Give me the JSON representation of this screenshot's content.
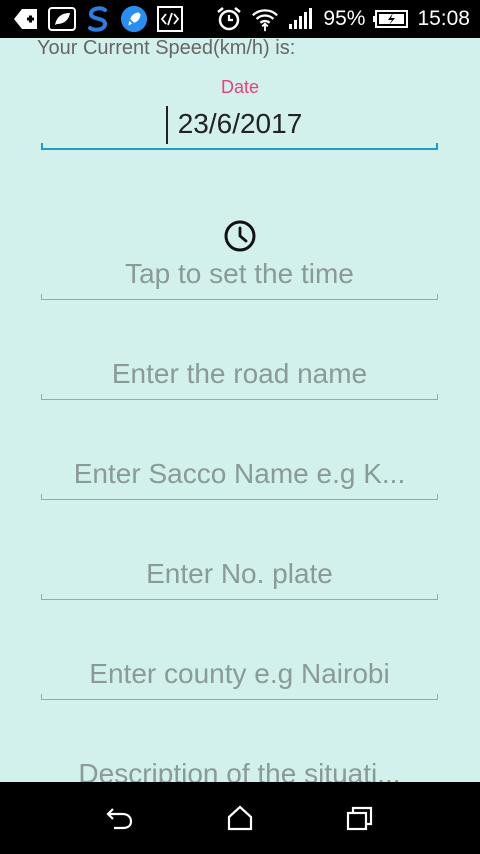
{
  "status_bar": {
    "battery_percent": "95%",
    "time": "15:08",
    "icons": [
      "add-notification-icon",
      "leaf-icon",
      "s-app-icon",
      "rocket-icon",
      "code-icon",
      "alarm-icon",
      "wifi-icon",
      "signal-icon",
      "battery-charging-icon"
    ]
  },
  "form": {
    "speed_label": "Your Current Speed(km/h) is:",
    "date_label": "Date",
    "date_value": "23/6/2017",
    "time_placeholder": "Tap to set the time",
    "road_placeholder": "Enter the road name",
    "sacco_placeholder": "Enter Sacco Name e.g K...",
    "plate_placeholder": "Enter No. plate",
    "county_placeholder": "Enter county e.g Nairobi",
    "description_placeholder": "Description of the situati..."
  },
  "colors": {
    "background": "#d3f1ec",
    "accent_label": "#e8427a",
    "focus_underline": "#1c9ec7",
    "placeholder": "#8a9a98"
  },
  "nav_bar": {
    "icons": [
      "back-icon",
      "home-icon",
      "recent-apps-icon"
    ]
  }
}
